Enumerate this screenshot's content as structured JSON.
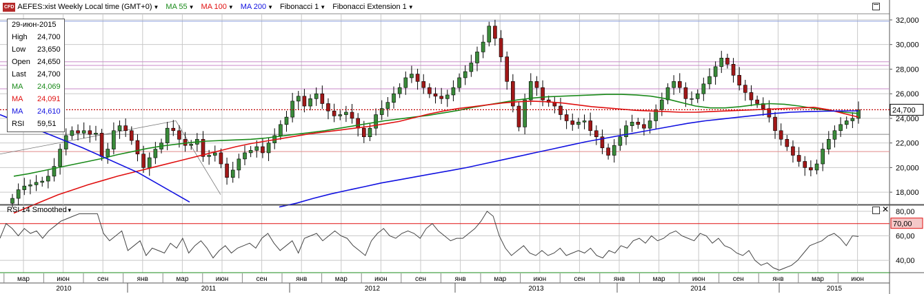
{
  "header": {
    "symbol_badge": "CFD",
    "symbol": "AEFES:xist Weekly Local time (GMT+0)",
    "indicators": [
      {
        "label": "MA 55",
        "color": "#1a8a1a"
      },
      {
        "label": "MA 100",
        "color": "#e01010"
      },
      {
        "label": "MA 200",
        "color": "#1010e0"
      },
      {
        "label": "Fibonacci 1",
        "color": "#000000"
      },
      {
        "label": "Fibonacci Extension 1",
        "color": "#000000"
      }
    ]
  },
  "infobox": {
    "date": "29-июн-2015",
    "rows": [
      {
        "k": "High",
        "v": "24,700",
        "color": "#000000"
      },
      {
        "k": "Low",
        "v": "23,650",
        "color": "#000000"
      },
      {
        "k": "Open",
        "v": "24,650",
        "color": "#000000"
      },
      {
        "k": "Last",
        "v": "24,700",
        "color": "#000000"
      },
      {
        "k": "MA",
        "v": "24,069",
        "color": "#1a8a1a"
      },
      {
        "k": "MA",
        "v": "24,091",
        "color": "#e01010"
      },
      {
        "k": "MA",
        "v": "24,610",
        "color": "#1010e0"
      },
      {
        "k": "RSI",
        "v": "59,51",
        "color": "#000000"
      }
    ]
  },
  "rsi_panel": {
    "title": "RSI 14 Smoothed"
  },
  "chart_data": [
    {
      "type": "candlestick",
      "title": "AEFES:xist Weekly",
      "ylim": [
        17000,
        32500
      ],
      "yticks": [
        18000,
        20000,
        22000,
        24000,
        26000,
        28000,
        30000,
        32000
      ],
      "ytick_labels": [
        "18,000",
        "20,000",
        "22,000",
        "24,000",
        "26,000",
        "28,000",
        "30,000",
        "32,000"
      ],
      "last_value": 24700,
      "last_label": "24,700",
      "fib_levels": [
        31900,
        28600,
        28300,
        26400,
        22700,
        21300
      ],
      "ohlc_close": [
        17500,
        18200,
        18500,
        18600,
        18800,
        18900,
        19300,
        20100,
        21500,
        22600,
        23000,
        22800,
        23000,
        22700,
        22800,
        20900,
        21500,
        23000,
        23400,
        23000,
        22200,
        21100,
        20000,
        20800,
        21500,
        22000,
        23200,
        23000,
        22300,
        21800,
        21900,
        22300,
        20900,
        21000,
        21200,
        20300,
        19200,
        19800,
        20700,
        21200,
        21400,
        21700,
        21200,
        22000,
        22600,
        23500,
        24100,
        25400,
        25800,
        25000,
        25600,
        26000,
        25200,
        24600,
        24200,
        24300,
        24500,
        24000,
        23200,
        22500,
        23200,
        24300,
        24800,
        25300,
        26000,
        26500,
        27300,
        27600,
        27000,
        26500,
        26000,
        25800,
        25600,
        25900,
        26500,
        27300,
        27800,
        28500,
        29400,
        30200,
        31500,
        30500,
        29000,
        27000,
        25000,
        23300,
        25500,
        27000,
        26500,
        25500,
        25300,
        25000,
        24300,
        23800,
        23500,
        23700,
        23800,
        23000,
        22500,
        21600,
        21000,
        21800,
        22500,
        23400,
        23700,
        23500,
        23200,
        23800,
        24700,
        25500,
        26500,
        27000,
        26500,
        25600,
        25600,
        26000,
        26800,
        27400,
        28200,
        28900,
        28400,
        27500,
        26700,
        26100,
        25500,
        25200,
        24800,
        24100,
        23000,
        22300,
        21700,
        21000,
        20500,
        20000,
        19800,
        20300,
        21500,
        22300,
        23000,
        23500,
        23800,
        24000,
        24700
      ],
      "ma55": [
        19300,
        19500,
        19750,
        20000,
        20250,
        20500,
        20750,
        21050,
        21300,
        21550,
        21750,
        21900,
        22050,
        22150,
        22200,
        22250,
        22300,
        22400,
        22550,
        22700,
        22850,
        23000,
        23200,
        23400,
        23600,
        23800,
        23950,
        24100,
        24250,
        24450,
        24650,
        24900,
        25100,
        25300,
        25500,
        25650,
        25750,
        25800,
        25850,
        25900,
        25950,
        25950,
        25900,
        25800,
        25600,
        25300,
        25000,
        24850,
        24850,
        24950,
        25100,
        25200,
        25150,
        25000,
        24800,
        24650,
        24500,
        24400
      ],
      "ma100": [
        16300,
        16800,
        17300,
        17800,
        18200,
        18600,
        18950,
        19300,
        19600,
        19900,
        20200,
        20500,
        20800,
        21100,
        21400,
        21700,
        21950,
        22150,
        22350,
        22550,
        22750,
        22900,
        23050,
        23200,
        23350,
        23550,
        23750,
        24050,
        24350,
        24600,
        24800,
        24950,
        25100,
        25250,
        25350,
        25400,
        25350,
        25250,
        25100,
        24950,
        24850,
        24750,
        24650,
        24600,
        24550,
        24500,
        24500,
        24550,
        24600,
        24650,
        24700,
        24750,
        24800,
        24850,
        24900,
        24700,
        24400,
        24100
      ],
      "ma200": [
        16800,
        17100,
        17500,
        17850,
        18150,
        18450,
        18750,
        19000,
        19250,
        19500,
        19750,
        20000,
        20300,
        20600,
        20900,
        21200,
        21500,
        21800,
        22100,
        22350,
        22600,
        22850,
        23100,
        23350,
        23600,
        23800,
        23950,
        24100,
        24250,
        24400,
        24500,
        24550,
        24580,
        24600,
        24610
      ],
      "rsi": {
        "ylim": [
          30,
          85
        ],
        "yticks": [
          40,
          60,
          80
        ],
        "ytick_labels": [
          "40,00",
          "60,00",
          "80,00"
        ],
        "overbought": 70,
        "overbought_label": "70,00",
        "oversold": 30,
        "values": [
          58,
          70,
          66,
          60,
          66,
          62,
          64,
          58,
          64,
          68,
          72,
          74,
          76,
          78,
          78,
          78,
          78,
          62,
          56,
          60,
          64,
          48,
          52,
          56,
          44,
          50,
          48,
          46,
          54,
          50,
          58,
          46,
          52,
          56,
          50,
          42,
          48,
          52,
          46,
          50,
          52,
          54,
          50,
          58,
          62,
          54,
          48,
          52,
          56,
          46,
          58,
          60,
          62,
          56,
          60,
          64,
          60,
          58,
          52,
          48,
          44,
          56,
          62,
          66,
          60,
          58,
          62,
          64,
          62,
          58,
          66,
          70,
          64,
          60,
          56,
          58,
          58,
          62,
          66,
          72,
          80,
          76,
          60,
          50,
          44,
          48,
          52,
          46,
          44,
          48,
          44,
          46,
          50,
          44,
          46,
          48,
          46,
          50,
          44,
          42,
          48,
          46,
          52,
          50,
          56,
          58,
          54,
          60,
          56,
          58,
          62,
          64,
          60,
          58,
          56,
          62,
          60,
          54,
          58,
          52,
          50,
          46,
          44,
          48,
          40,
          36,
          38,
          34,
          32,
          34,
          36,
          40,
          46,
          52,
          54,
          56,
          60,
          62,
          58,
          52,
          60,
          59.51
        ]
      },
      "x_axis": {
        "months": [
          "мар",
          "июн",
          "сен",
          "янв",
          "мар",
          "июн",
          "сен",
          "янв",
          "мар",
          "июн",
          "сен",
          "янв",
          "мар",
          "июн",
          "сен",
          "янв",
          "мар",
          "июн",
          "сен",
          "янв",
          "мар",
          "июн"
        ],
        "years": [
          "2010",
          "2011",
          "2012",
          "2013",
          "2014",
          "2015"
        ]
      }
    }
  ]
}
